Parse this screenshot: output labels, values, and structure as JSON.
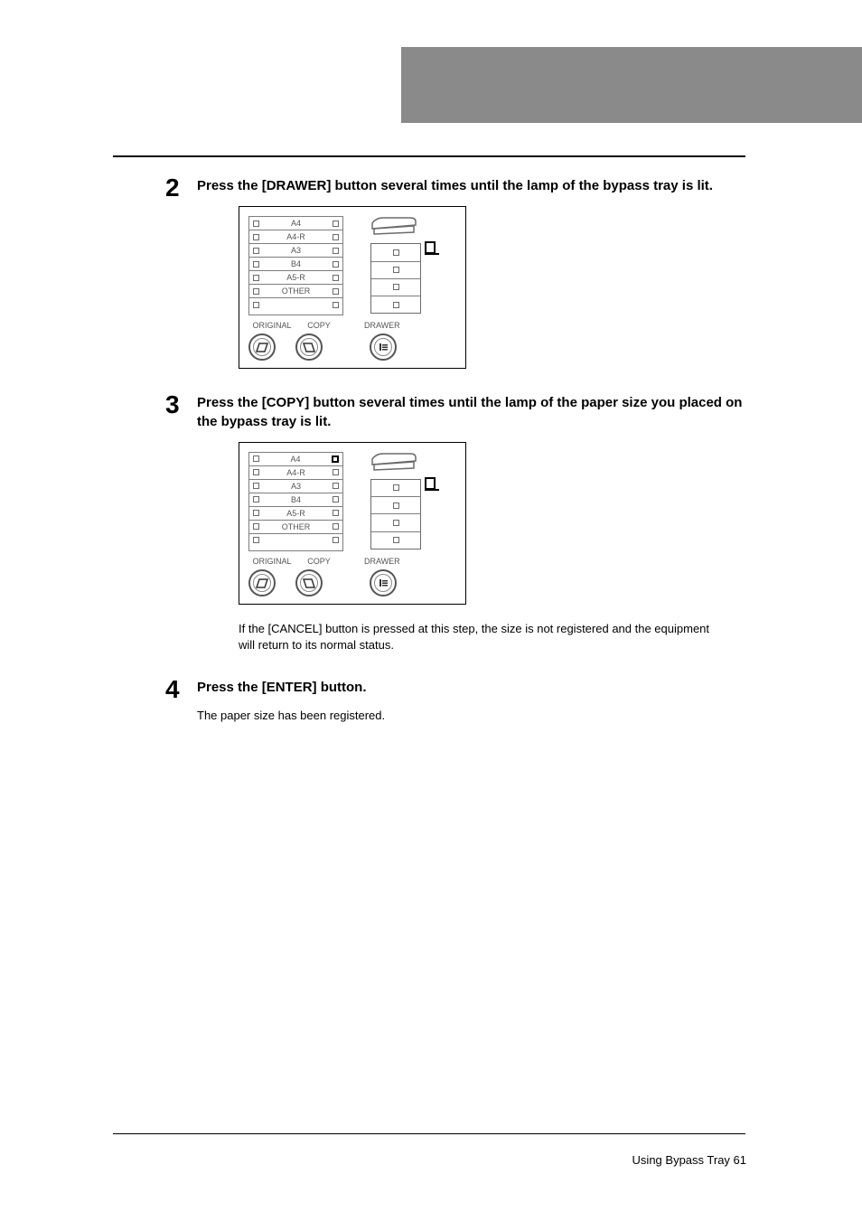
{
  "steps": {
    "s2": {
      "num": "2",
      "title": "Press the [DRAWER] button several times until the lamp of the bypass tray is lit."
    },
    "s3": {
      "num": "3",
      "title": "Press the [COPY] button several times until the lamp of the paper size you placed on the bypass tray is lit.",
      "note": "If the [CANCEL] button is pressed at this step, the size is not registered and the equipment will return to its normal status."
    },
    "s4": {
      "num": "4",
      "title": "Press the [ENTER] button.",
      "body": "The paper size has been registered."
    }
  },
  "panel": {
    "sizes": [
      "A4",
      "A4-R",
      "A3",
      "B4",
      "A5-R",
      "OTHER"
    ],
    "labels": {
      "original": "ORIGINAL",
      "copy": "COPY",
      "drawer": "DRAWER"
    }
  },
  "footer": {
    "text": "Using Bypass Tray    61"
  }
}
